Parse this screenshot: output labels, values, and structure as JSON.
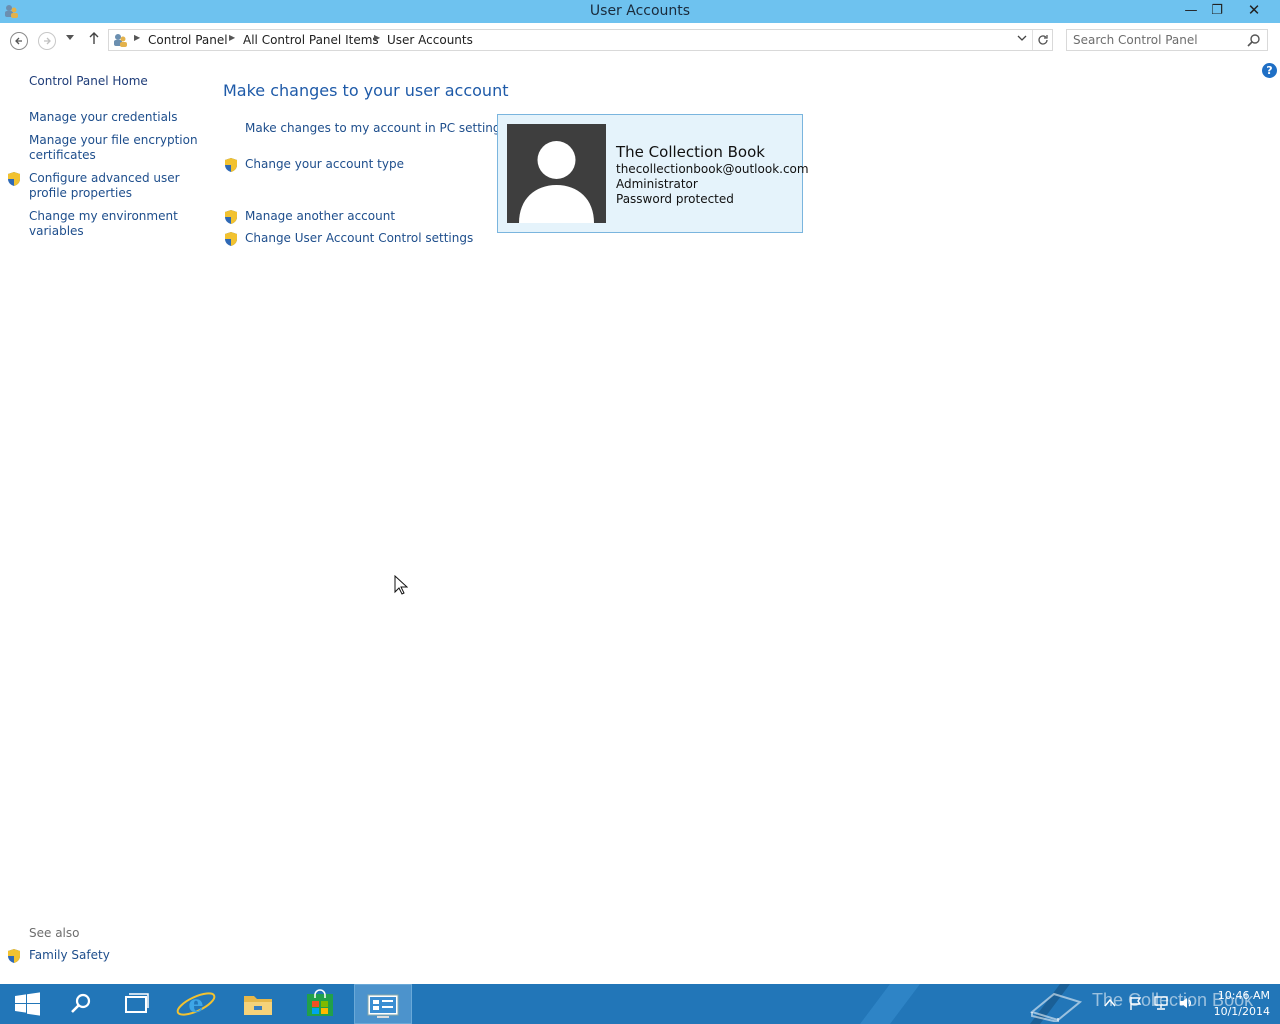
{
  "window": {
    "title": "User Accounts",
    "min_glyph": "—",
    "max_glyph": "❐",
    "close_glyph": "✕"
  },
  "nav": {
    "breadcrumbs": [
      "Control Panel",
      "All Control Panel Items",
      "User Accounts"
    ],
    "search_placeholder": "Search Control Panel"
  },
  "help_glyph": "?",
  "left_pane": {
    "home": "Control Panel Home",
    "links": [
      "Manage your credentials",
      "Manage your file encryption\ncertificates",
      "Configure advanced user\nprofile properties",
      "Change my environment\nvariables"
    ],
    "see_also_label": "See also",
    "see_also_links": [
      "Family Safety"
    ]
  },
  "main": {
    "heading": "Make changes to your user account",
    "links": [
      "Make changes to my account in PC settings",
      "Change your account type",
      "Manage another account",
      "Change User Account Control settings"
    ]
  },
  "account": {
    "name": "The Collection Book",
    "email": "thecollectionbook@outlook.com",
    "role": "Administrator",
    "status": "Password protected"
  },
  "taskbar": {
    "items": [
      "start-icon",
      "search-icon",
      "task-view-icon",
      "internet-explorer-icon",
      "file-explorer-icon",
      "store-icon",
      "control-panel-icon"
    ],
    "watermark": "The Collection Book",
    "time": "10:46 AM",
    "date": "10/1/2014"
  },
  "colors": {
    "titlebar": "#6ec2ef",
    "taskbar": "#2276b8",
    "link": "#1e4e8c",
    "card_bg": "#e5f3fb",
    "card_border": "#7ab5de"
  }
}
